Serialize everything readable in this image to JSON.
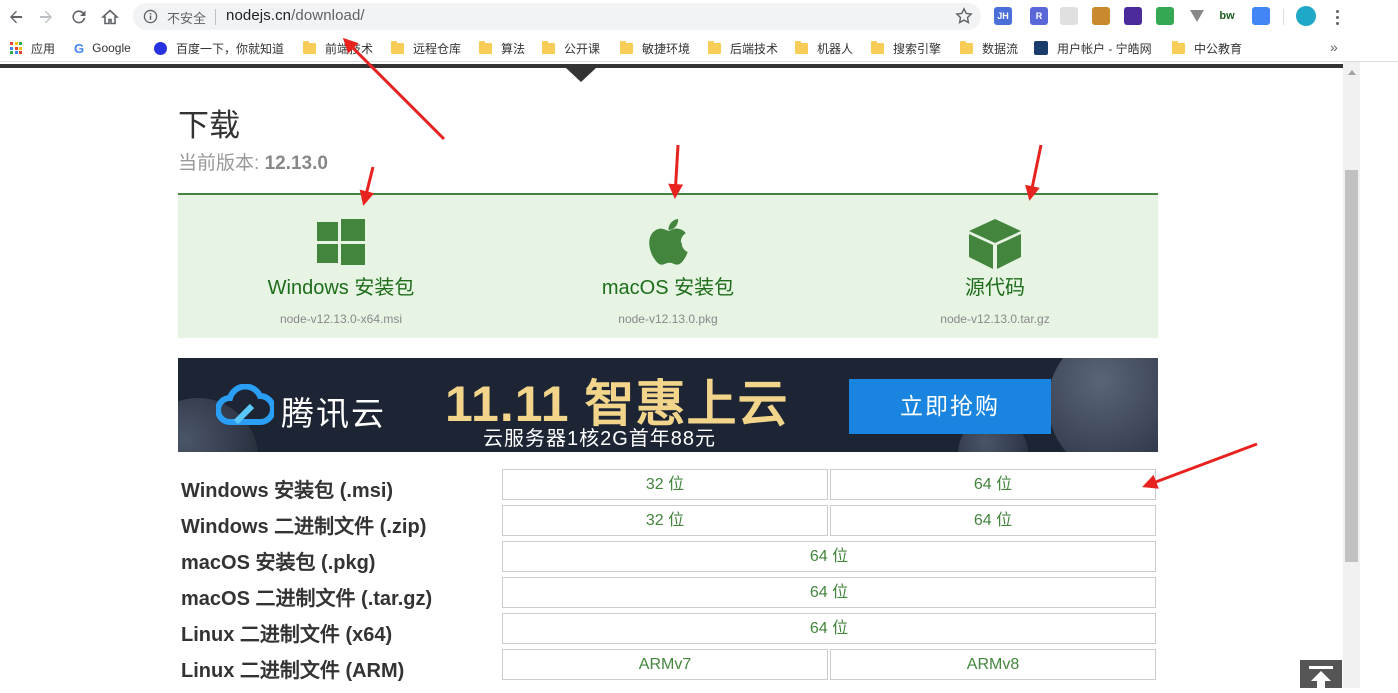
{
  "browser": {
    "security_label": "不安全",
    "url_host": "nodejs.cn",
    "url_path": "/download/"
  },
  "extensions": [
    {
      "name": "jh-extension-icon",
      "text": "JH",
      "color": "#4a6fd8"
    },
    {
      "name": "r-extension-icon",
      "text": "R",
      "color": "#5a67d8"
    },
    {
      "name": "grey-extension-icon",
      "text": "",
      "color": "#e0e0e0"
    },
    {
      "name": "owl-extension-icon",
      "text": "",
      "color": "#c88a2c"
    },
    {
      "name": "diamond-extension-icon",
      "text": "",
      "color": "#4b2a9c"
    },
    {
      "name": "download-extension-icon",
      "text": "",
      "color": "#34a853"
    },
    {
      "name": "v-extension-icon",
      "text": "",
      "color": "#888888"
    },
    {
      "name": "bw-extension-icon",
      "text": "bw",
      "color": "#ffffff"
    },
    {
      "name": "translate-extension-icon",
      "text": "",
      "color": "#4285f4"
    },
    {
      "name": "profile-avatar-icon",
      "text": "",
      "color": "#1ea9c8"
    }
  ],
  "bookmarks": [
    {
      "label": "应用",
      "type": "apps"
    },
    {
      "label": "Google",
      "type": "google"
    },
    {
      "label": "百度一下，你就知道",
      "type": "baidu"
    },
    {
      "label": "前端技术",
      "type": "folder"
    },
    {
      "label": "远程仓库",
      "type": "folder"
    },
    {
      "label": "算法",
      "type": "folder"
    },
    {
      "label": "公开课",
      "type": "folder"
    },
    {
      "label": "敏捷环境",
      "type": "folder"
    },
    {
      "label": "后端技术",
      "type": "folder"
    },
    {
      "label": "机器人",
      "type": "folder"
    },
    {
      "label": "搜索引擎",
      "type": "folder"
    },
    {
      "label": "数据流",
      "type": "folder"
    },
    {
      "label": "用户帐户 - 宁皓网",
      "type": "site"
    },
    {
      "label": "中公教育",
      "type": "folder"
    }
  ],
  "bookmarks_more": "»",
  "page": {
    "title": "下载",
    "version_label": "当前版本: ",
    "version_value": "12.13.0"
  },
  "downloads": [
    {
      "label": "Windows 安装包",
      "file": "node-v12.13.0-x64.msi",
      "icon": "windows-icon"
    },
    {
      "label": "macOS 安装包",
      "file": "node-v12.13.0.pkg",
      "icon": "apple-icon"
    },
    {
      "label": "源代码",
      "file": "node-v12.13.0.tar.gz",
      "icon": "box-icon"
    }
  ],
  "banner": {
    "brand": "腾讯云",
    "headline": "11.11 智惠上云",
    "sub": "云服务器1核2G首年88元",
    "cta": "立即抢购"
  },
  "table": [
    {
      "label": "Windows 安装包 (.msi)",
      "cells": [
        "32 位",
        "64 位"
      ]
    },
    {
      "label": "Windows 二进制文件 (.zip)",
      "cells": [
        "32 位",
        "64 位"
      ]
    },
    {
      "label": "macOS 安装包 (.pkg)",
      "cells": [
        "64 位"
      ]
    },
    {
      "label": "macOS 二进制文件 (.tar.gz)",
      "cells": [
        "64 位"
      ]
    },
    {
      "label": "Linux 二进制文件 (x64)",
      "cells": [
        "64 位"
      ]
    },
    {
      "label": "Linux 二进制文件 (ARM)",
      "cells": [
        "ARMv7",
        "ARMv8"
      ]
    }
  ],
  "colors": {
    "accent_green": "#43853d",
    "panel_bg": "#e7f4e4",
    "annotation_red": "#e8231f"
  }
}
